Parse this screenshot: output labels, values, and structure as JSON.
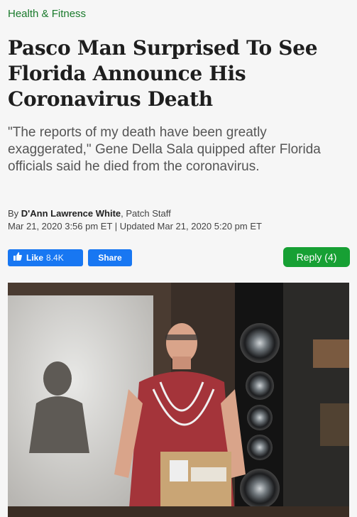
{
  "article": {
    "category": "Health & Fitness",
    "headline": "Pasco Man Surprised To See Florida Announce His Coronavirus Death",
    "dek": "\"The reports of my death have been greatly exaggerated,\" Gene Della Sala quipped after Florida officials said he died from the coronavirus.",
    "byline_prefix": "By ",
    "author": "D'Ann Lawrence White",
    "byline_suffix": ", Patch Staff",
    "dateline": "Mar 21, 2020 3:56 pm ET | Updated Mar 21, 2020 5:20 pm ET"
  },
  "actions": {
    "like_label": "Like",
    "like_count": "8.4K",
    "share_label": "Share",
    "reply_label": "Reply (4)"
  },
  "colors": {
    "category": "#1a7a2c",
    "facebook": "#1877f2",
    "reply": "#17a034"
  },
  "icons": {
    "like": "thumbs-up-icon"
  }
}
